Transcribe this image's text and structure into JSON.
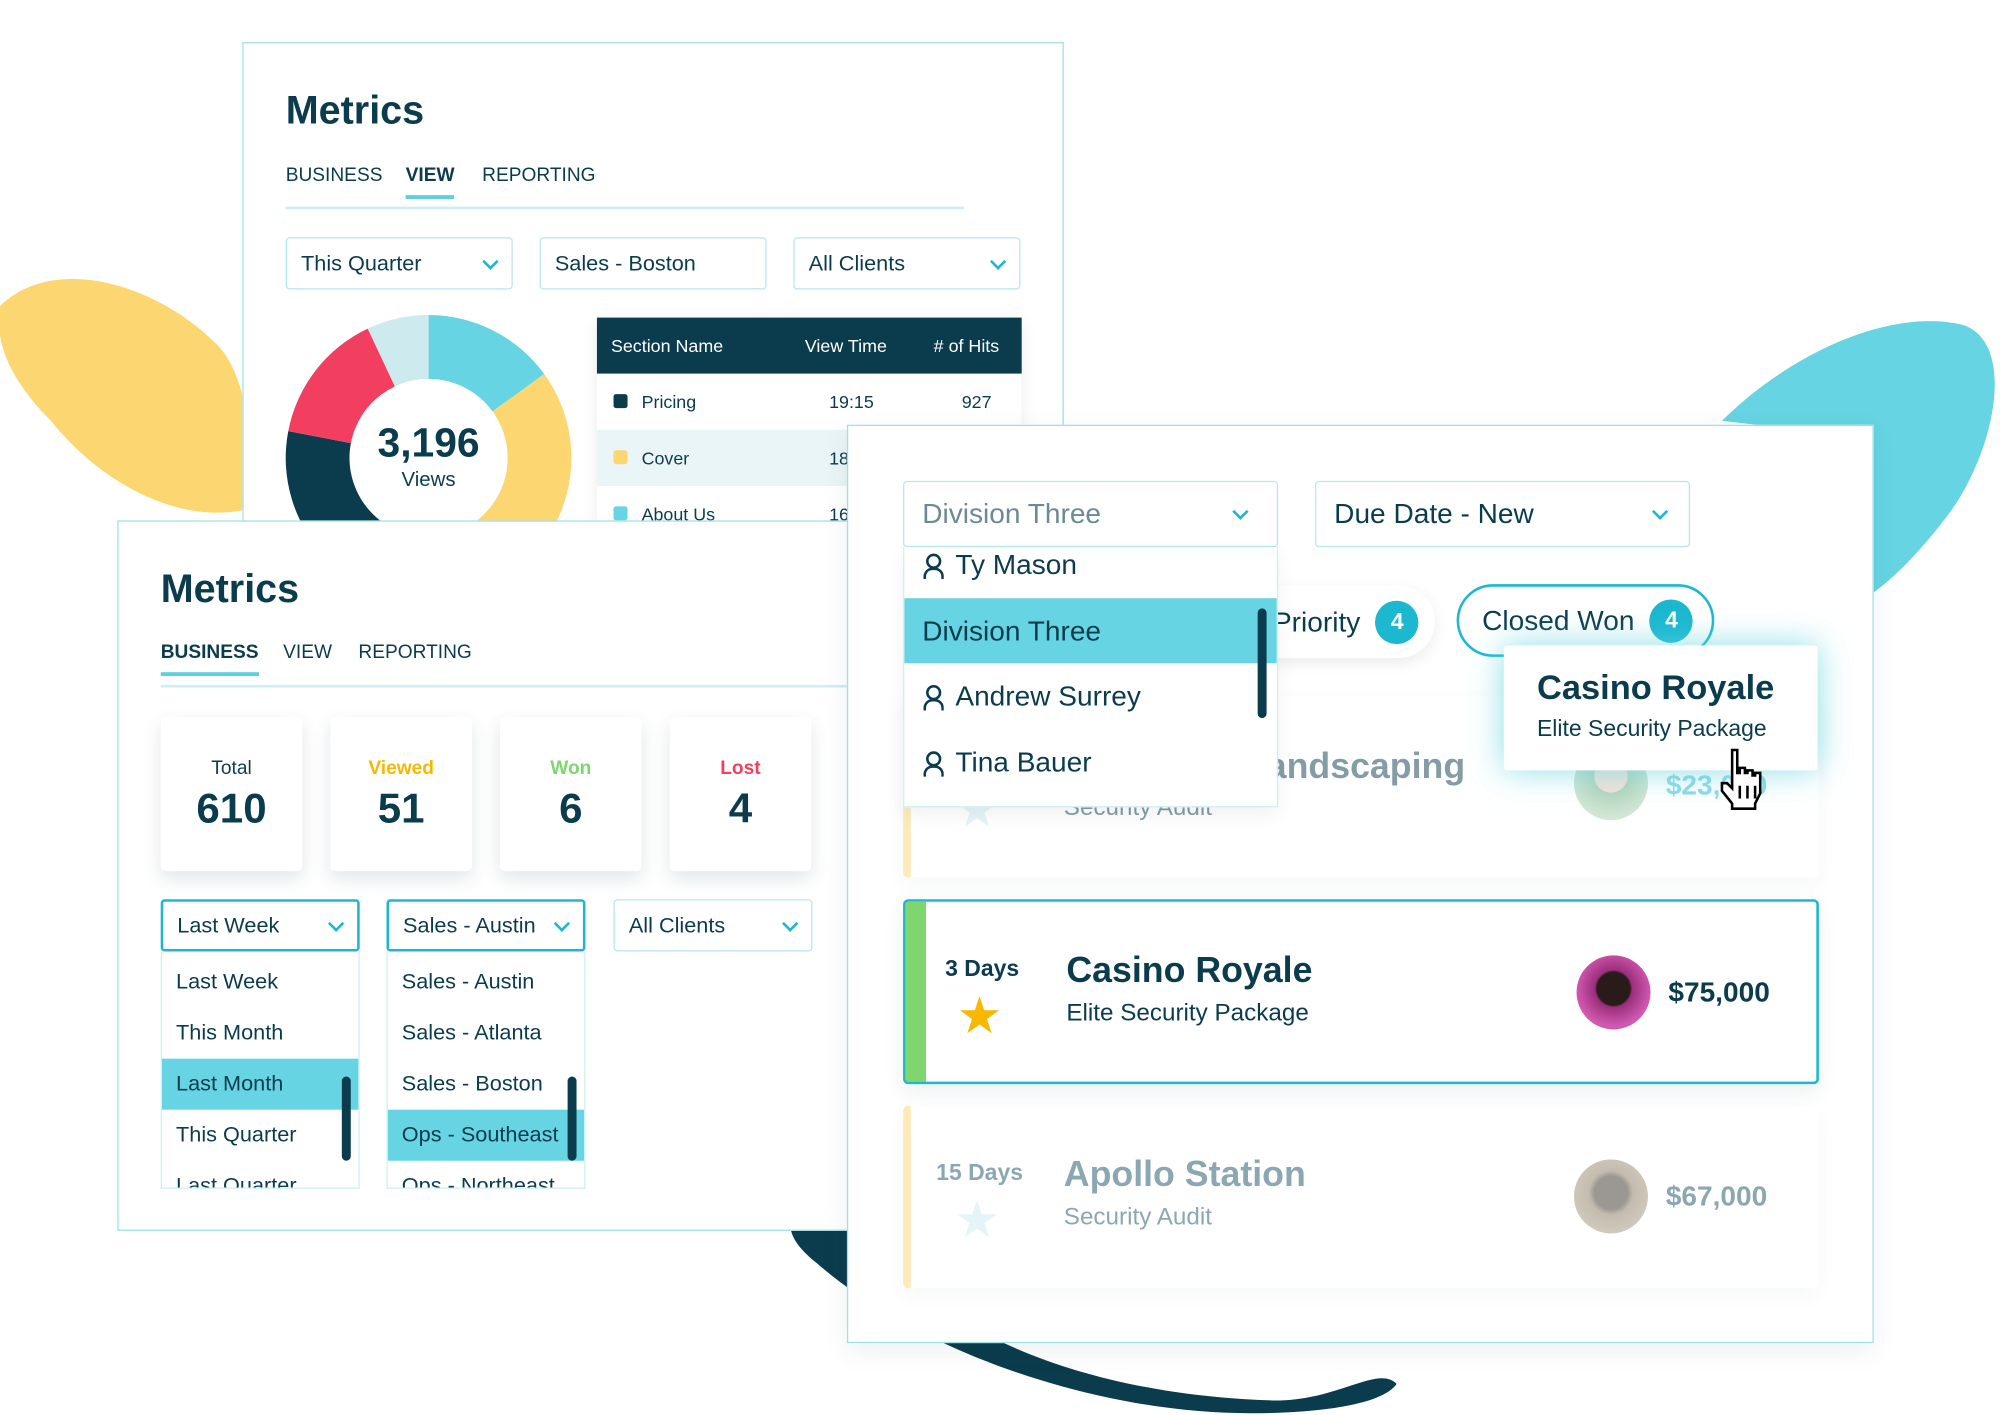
{
  "colors": {
    "dark": "#0b3c4d",
    "teal": "#66d4e2",
    "accent": "#1bb8d0",
    "yellow": "#fcd670",
    "red": "#f23f5f",
    "green": "#7fd66e",
    "light": "#cdeaee"
  },
  "back_panel": {
    "title": "Metrics",
    "tabs": [
      {
        "label": "BUSINESS",
        "active": false
      },
      {
        "label": "VIEW",
        "active": true
      },
      {
        "label": "REPORTING",
        "active": false
      }
    ],
    "filters": [
      "This Quarter",
      "Sales - Boston",
      "All Clients"
    ],
    "donut": {
      "value": "3,196",
      "label": "Views",
      "segments": [
        {
          "color": "#66d4e2",
          "pct": 15
        },
        {
          "color": "#fcd670",
          "pct": 32
        },
        {
          "color": "#0b3c4d",
          "pct": 31
        },
        {
          "color": "#f23f5f",
          "pct": 15
        },
        {
          "color": "#cdeaee",
          "pct": 7
        }
      ]
    },
    "table": {
      "headers": [
        "Section Name",
        "View Time",
        "# of Hits"
      ],
      "rows": [
        {
          "name": "Pricing",
          "time": "19:15",
          "hits": "927",
          "color": "#0b3c4d"
        },
        {
          "name": "Cover",
          "time": "18",
          "hits": "",
          "color": "#fcd670"
        },
        {
          "name": "About Us",
          "time": "16",
          "hits": "",
          "color": "#66d4e2"
        }
      ]
    }
  },
  "front_panel": {
    "title": "Metrics",
    "tabs": [
      {
        "label": "BUSINESS",
        "active": true
      },
      {
        "label": "VIEW",
        "active": false
      },
      {
        "label": "REPORTING",
        "active": false
      }
    ],
    "stats": [
      {
        "label": "Total",
        "value": "610",
        "color": "#0b3c4d"
      },
      {
        "label": "Viewed",
        "value": "51",
        "color": "#f9b800"
      },
      {
        "label": "Won",
        "value": "6",
        "color": "#7fd66e"
      },
      {
        "label": "Lost",
        "value": "4",
        "color": "#f23f5f"
      }
    ],
    "period": {
      "selected": "Last Week",
      "options": [
        "Last Week",
        "This Month",
        "Last Month",
        "This Quarter",
        "Last Quarter"
      ],
      "highlighted": "Last Month"
    },
    "team": {
      "selected": "Sales - Austin",
      "options": [
        "Sales - Austin",
        "Sales - Atlanta",
        "Sales - Boston",
        "Ops - Southeast",
        "Ops - Northeast"
      ],
      "highlighted": "Ops - Southeast"
    },
    "clients": {
      "selected": "All Clients"
    }
  },
  "deals_panel": {
    "division": {
      "selected": "Division Three",
      "options": [
        "Ty Mason",
        "Division Three",
        "Andrew Surrey",
        "Tina Bauer"
      ],
      "highlighted": "Division Three"
    },
    "sort": {
      "selected": "Due Date - New"
    },
    "pills": [
      {
        "label": "Priority",
        "count": "4"
      },
      {
        "label": "Closed Won",
        "count": "4"
      }
    ],
    "tooltip": {
      "title": "Casino Royale",
      "subtitle": "Elite Security Package"
    },
    "cards": [
      {
        "days": "",
        "title": "Landscaping",
        "subtitle": "Security Audit",
        "amount": "$23,000",
        "bar": "#fcd670",
        "starred": false
      },
      {
        "days": "3 Days",
        "title": "Casino Royale",
        "subtitle": "Elite Security Package",
        "amount": "$75,000",
        "bar": "#7fd66e",
        "starred": true
      },
      {
        "days": "15 Days",
        "title": "Apollo Station",
        "subtitle": "Security Audit",
        "amount": "$67,000",
        "bar": "#fcd670",
        "starred": false
      }
    ]
  }
}
